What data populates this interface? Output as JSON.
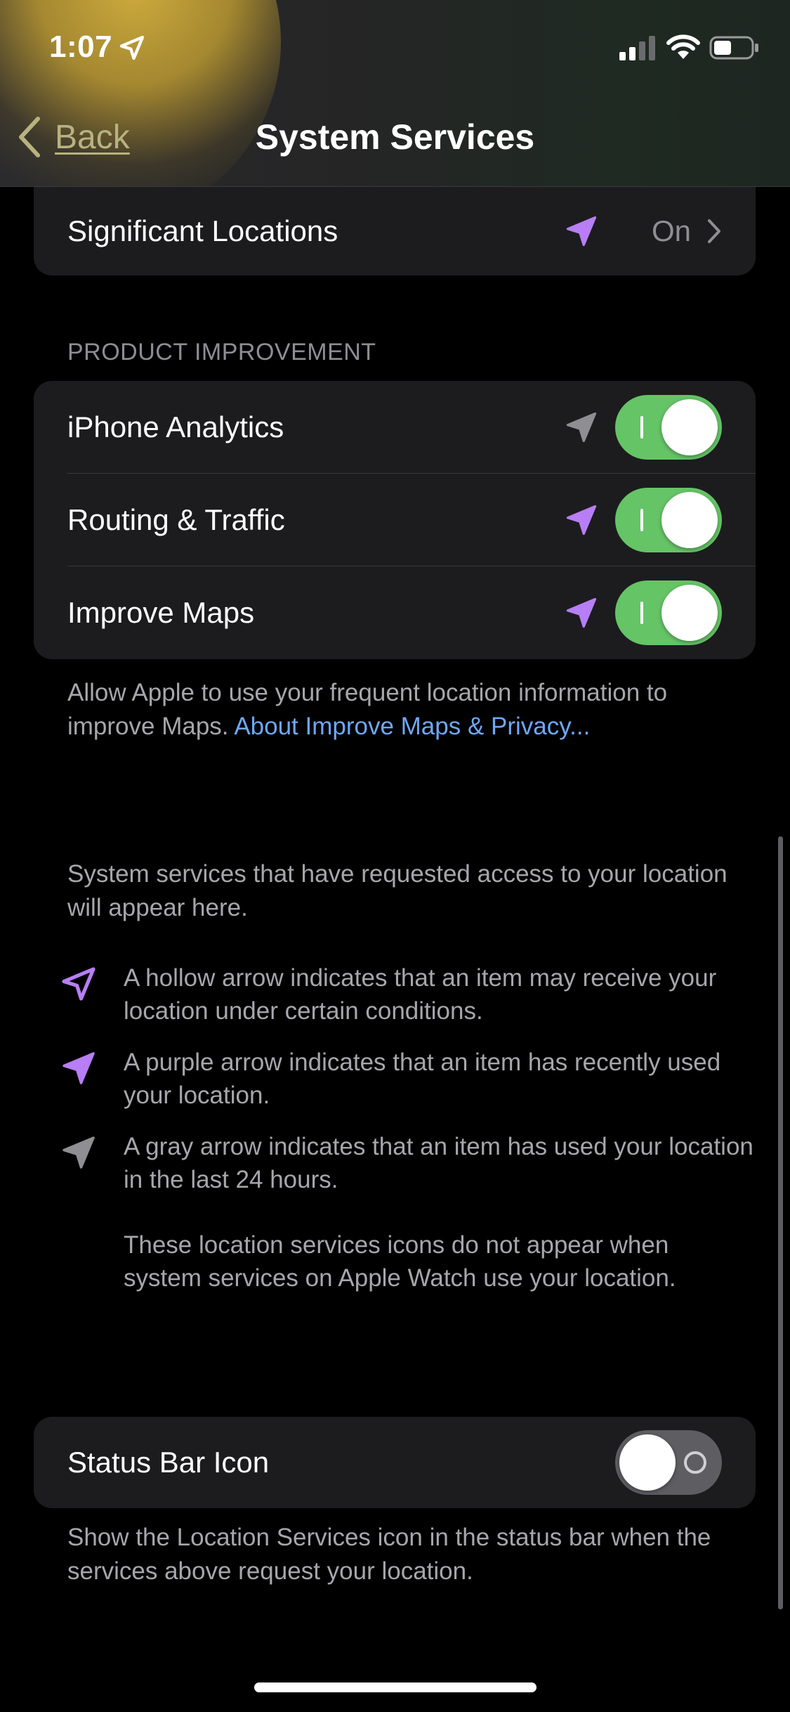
{
  "status_bar": {
    "time": "1:07",
    "location_icon": "location-arrow-icon",
    "signal_icon": "cellular-signal-icon",
    "wifi_icon": "wifi-icon",
    "battery_icon": "battery-icon"
  },
  "nav": {
    "back_label": "Back",
    "title": "System Services"
  },
  "significant_locations": {
    "label": "Significant Locations",
    "value": "On",
    "arrow": "purple"
  },
  "product_improvement": {
    "header": "PRODUCT IMPROVEMENT",
    "items": [
      {
        "label": "iPhone Analytics",
        "arrow": "gray",
        "enabled": true
      },
      {
        "label": "Routing & Traffic",
        "arrow": "purple",
        "enabled": true
      },
      {
        "label": "Improve Maps",
        "arrow": "purple",
        "enabled": true
      }
    ],
    "footnote_text": "Allow Apple to use your frequent location information to improve Maps. ",
    "footnote_link": "About Improve Maps & Privacy..."
  },
  "legend": {
    "intro": "System services that have requested access to your location will appear here.",
    "items": [
      {
        "arrow": "hollow",
        "text": "A hollow arrow indicates that an item may receive your location under certain conditions."
      },
      {
        "arrow": "purple",
        "text": "A purple arrow indicates that an item has recently used your location."
      },
      {
        "arrow": "gray",
        "text": "A gray arrow indicates that an item has used your location in the last 24 hours."
      }
    ],
    "watch_note": "These location services icons do not appear when system services on Apple Watch use your location."
  },
  "status_bar_icon": {
    "label": "Status Bar Icon",
    "enabled": false,
    "footnote": "Show the Location Services icon in the status bar when the services above request your location."
  },
  "colors": {
    "purple_arrow": "#b87ef5",
    "gray_arrow": "#8e8e93",
    "toggle_on": "#65c466",
    "toggle_off": "#5d5d62",
    "link": "#6ea7f5",
    "card_bg": "#1c1c1e"
  }
}
